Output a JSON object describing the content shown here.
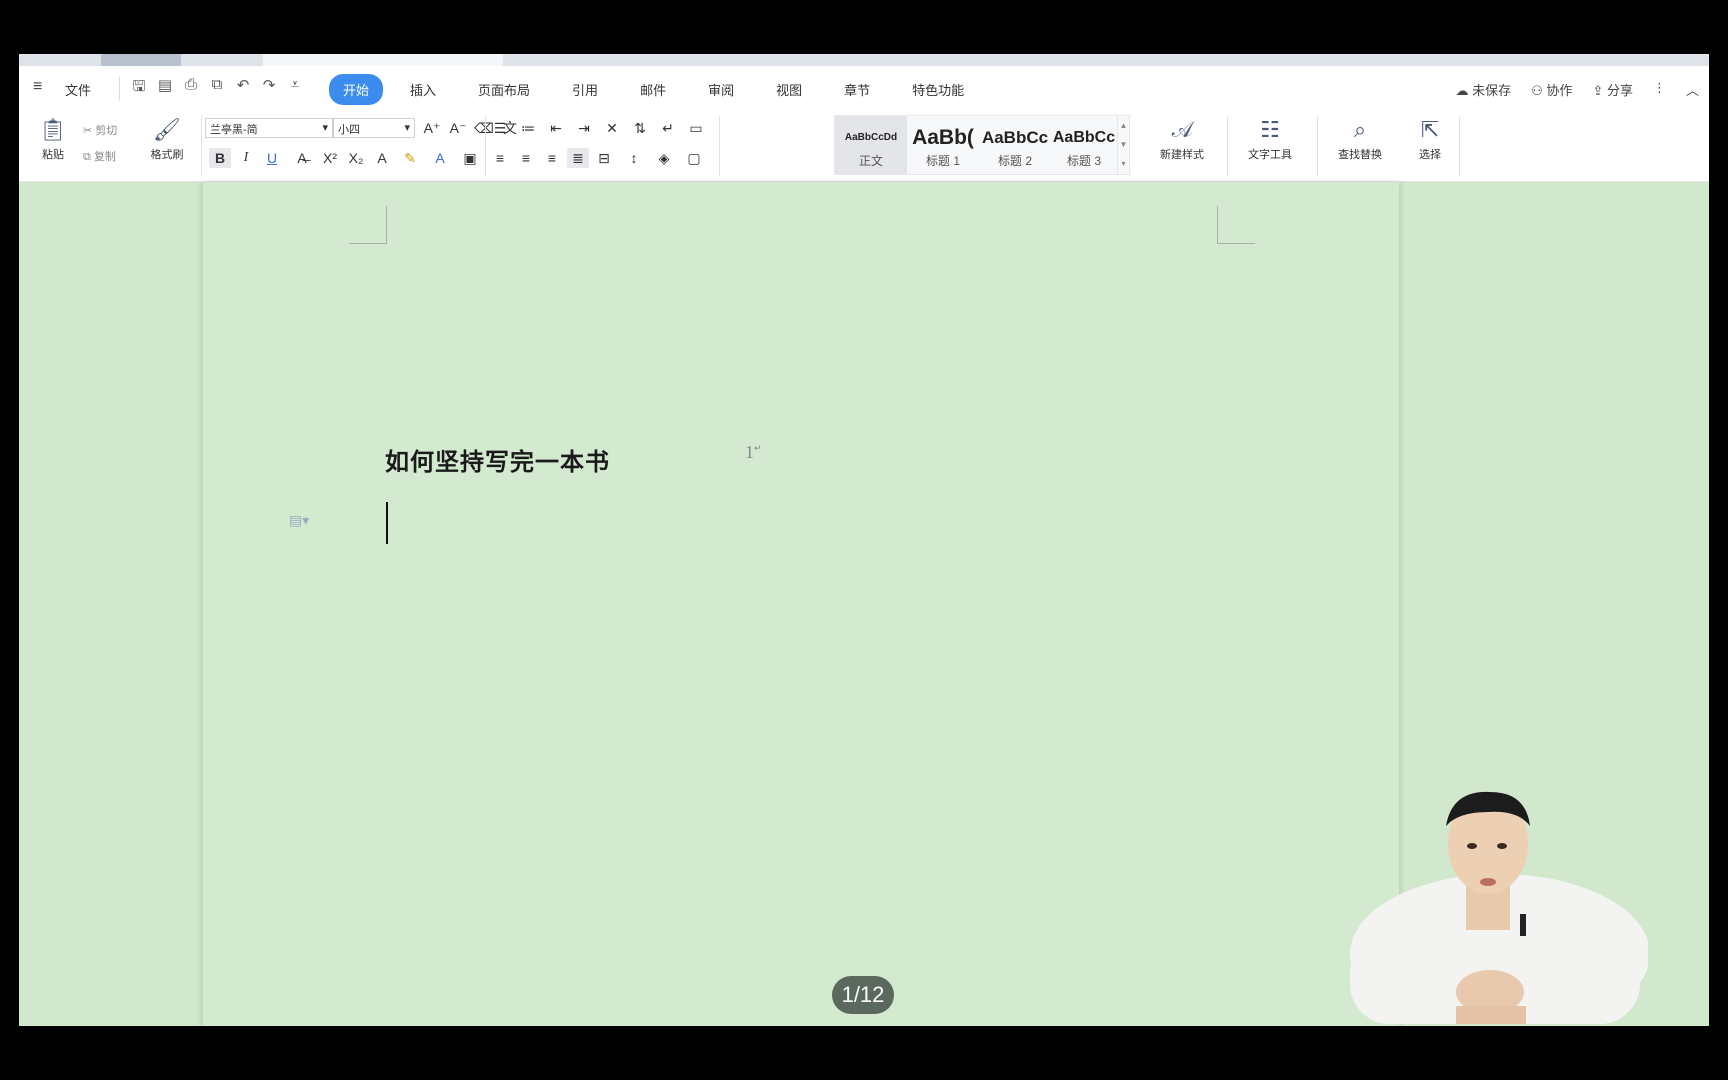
{
  "menu": {
    "file_label": "文件",
    "tabs": [
      {
        "label": "开始",
        "active": true
      },
      {
        "label": "插入"
      },
      {
        "label": "页面布局"
      },
      {
        "label": "引用"
      },
      {
        "label": "邮件"
      },
      {
        "label": "审阅"
      },
      {
        "label": "视图"
      },
      {
        "label": "章节"
      },
      {
        "label": "特色功能"
      }
    ],
    "right": {
      "save": "未保存",
      "collab": "协作",
      "share": "分享"
    }
  },
  "ribbon": {
    "paste": "粘贴",
    "cut": "剪切",
    "copy": "复制",
    "format_painter": "格式刷",
    "font_name": "兰亭黑-简",
    "font_size": "小四",
    "styles": [
      {
        "preview": "AaBbCcDd",
        "name": "正文",
        "selected": true
      },
      {
        "preview": "AaBb(",
        "name": "标题 1"
      },
      {
        "preview": "AaBbCc",
        "name": "标题 2"
      },
      {
        "preview": "AaBbCc",
        "name": "标题 3"
      }
    ],
    "new_style": "新建样式",
    "text_tools": "文字工具",
    "find_replace": "查找替换",
    "select": "选择"
  },
  "document": {
    "title": "如何坚持写完一本书",
    "page_mark": "1"
  },
  "page_counter": "1/12",
  "colors": {
    "accent": "#3c8cf0",
    "page_bg": "#d3ead0"
  }
}
